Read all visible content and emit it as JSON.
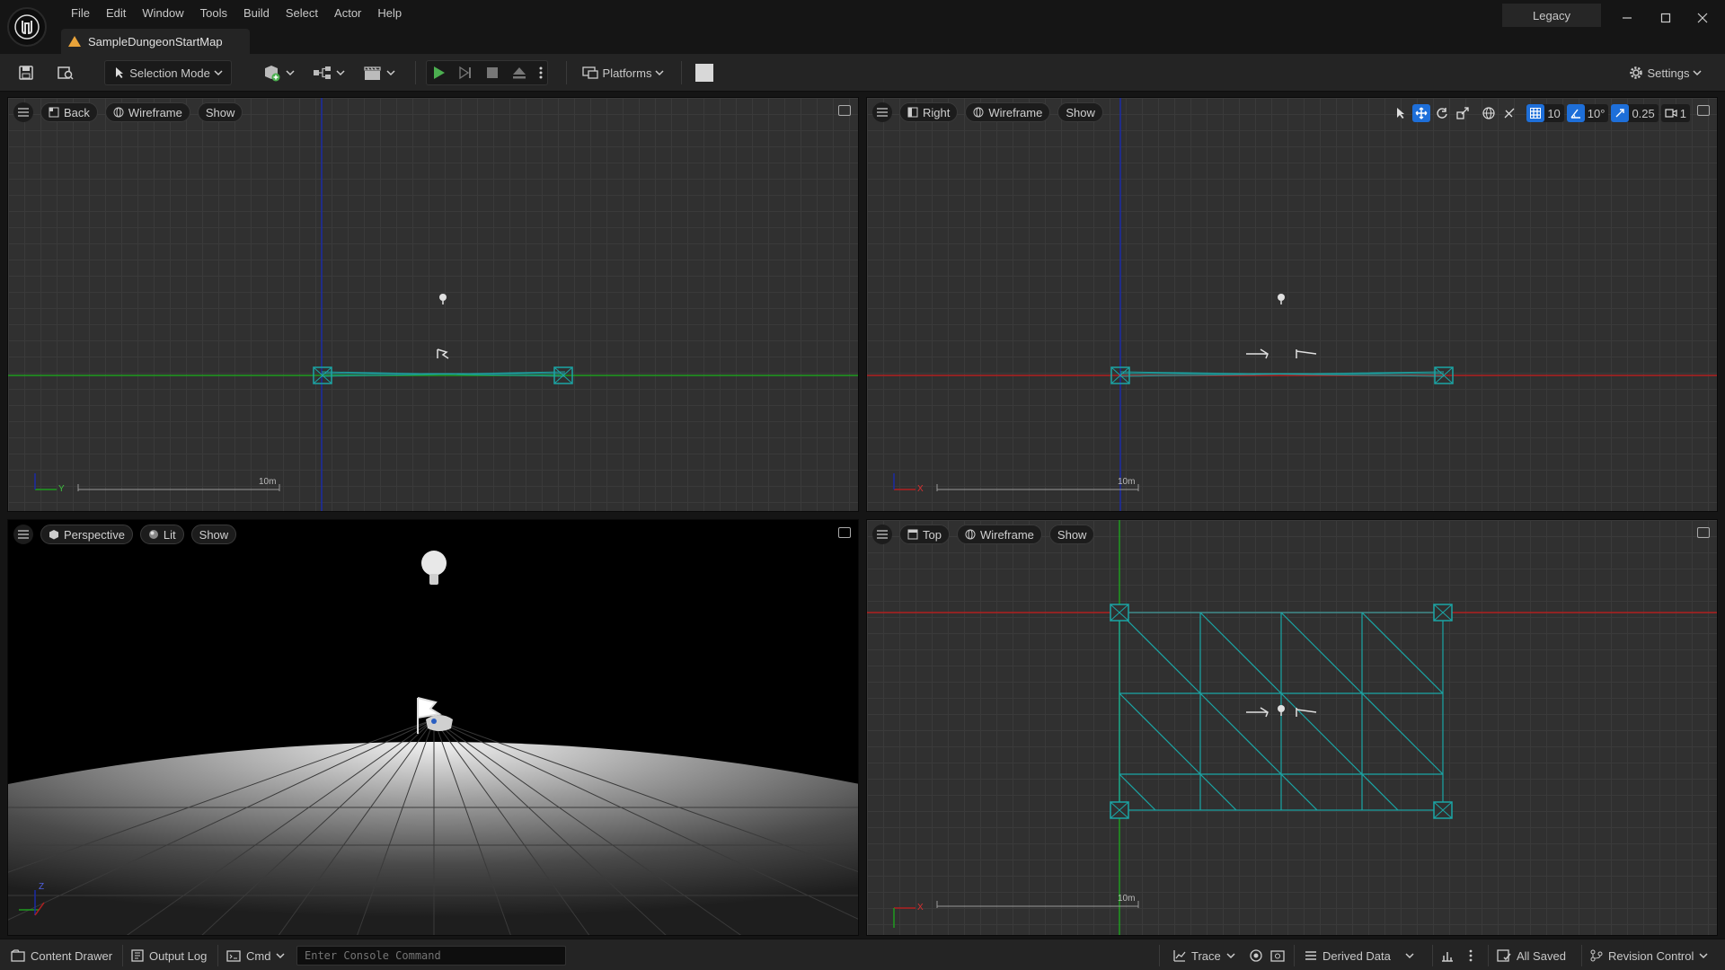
{
  "menus": [
    "File",
    "Edit",
    "Window",
    "Tools",
    "Build",
    "Select",
    "Actor",
    "Help"
  ],
  "document_tab": "SampleDungeonStartMap",
  "layout_mode": "Legacy",
  "toolbar": {
    "selection_mode": "Selection Mode",
    "platforms": "Platforms",
    "settings": "Settings"
  },
  "viewports": {
    "back": {
      "view": "Back",
      "mode": "Wireframe",
      "show": "Show",
      "scale": "10m",
      "axis_h": "Y"
    },
    "right": {
      "view": "Right",
      "mode": "Wireframe",
      "show": "Show",
      "scale": "10m",
      "axis_h": "X",
      "snap": {
        "grid": "10",
        "rotation": "10°",
        "scale": "0.25",
        "camera_speed": "1"
      }
    },
    "perspective": {
      "view": "Perspective",
      "mode": "Lit",
      "show": "Show",
      "axis_v": "Z"
    },
    "top": {
      "view": "Top",
      "mode": "Wireframe",
      "show": "Show",
      "scale": "10m",
      "axis_h": "X"
    }
  },
  "statusbar": {
    "content_drawer": "Content Drawer",
    "output_log": "Output Log",
    "cmd": "Cmd",
    "console_placeholder": "Enter Console Command",
    "trace": "Trace",
    "derived_data": "Derived Data",
    "all_saved": "All Saved",
    "revision_control": "Revision Control"
  },
  "colors": {
    "accent": "#1e6fd9",
    "play": "#4caf50",
    "wireframe": "#1aa6a6",
    "axis_x": "#b02020",
    "axis_y": "#1f9a1f",
    "axis_z": "#1a2aa6"
  }
}
